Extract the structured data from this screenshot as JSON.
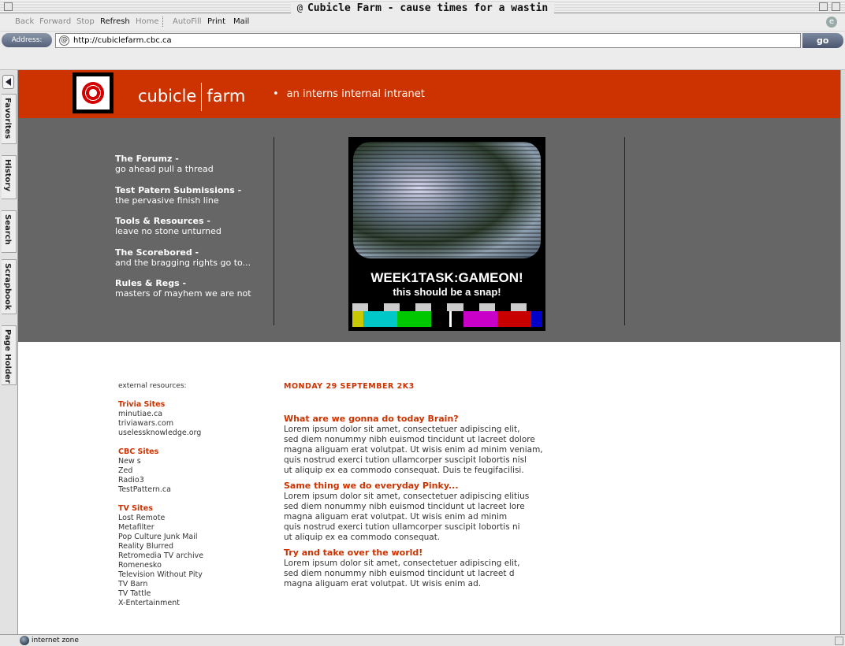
{
  "window": {
    "title": "Cubicle Farm - cause times for a wastin"
  },
  "toolbar": {
    "back": "Back",
    "forward": "Forward",
    "stop": "Stop",
    "refresh": "Refresh",
    "home": "Home",
    "autofill": "AutoFill",
    "print": "Print",
    "mail": "Mail"
  },
  "address": {
    "label": "Address:",
    "url": "http://cubiclefarm.cbc.ca",
    "go": "go"
  },
  "sidebar": {
    "tabs": [
      "Favorites",
      "History",
      "Search",
      "Scrapbook",
      "Page Holder"
    ]
  },
  "site": {
    "brand_left": "cubicle",
    "brand_right": "farm",
    "tagline": "an interns internal intranet",
    "nav": [
      {
        "title": "The Forumz -",
        "sub": "go ahead pull a thread"
      },
      {
        "title": "Test Patern Submissions -",
        "sub": "the pervasive finish line"
      },
      {
        "title": "Tools & Resources -",
        "sub": "leave no stone unturned"
      },
      {
        "title": "The Scorebored -",
        "sub": "and the bragging rights go to..."
      },
      {
        "title": "Rules & Regs -",
        "sub": "masters of mayhem we are not"
      }
    ],
    "promo": {
      "headline": "WEEK1TASK:GAMEON!",
      "subline": "this should be a snap!"
    },
    "external_label": "external resources:",
    "link_sections": [
      {
        "heading": "Trivia Sites",
        "items": [
          "minutiae.ca",
          "triviawars.com",
          "uselessknowledge.org"
        ]
      },
      {
        "heading": "CBC Sites",
        "items": [
          "New s",
          "Zed",
          "Radio3",
          "TestPattern.ca"
        ]
      },
      {
        "heading": "TV Sites",
        "items": [
          "Lost Remote",
          "Metafilter",
          "Pop Culture Junk Mail",
          "Reality Blurred",
          "Retromedia TV archive",
          "Romenesko",
          "Television Without Pity",
          "TV Barn",
          "TV Tattle",
          "X-Entertainment"
        ]
      }
    ],
    "date": "MONDAY 29 SEPTEMBER 2K3",
    "posts": [
      {
        "heading": "What are we gonna do today Brain?",
        "lines": [
          "Lorem ipsum dolor sit amet, consectetuer adipiscing elit,",
          "sed diem nonummy nibh euismod tincidunt ut lacreet dolore",
          "magna aliguam erat volutpat. Ut wisis enim ad minim veniam,",
          "quis nostrud exerci tution ullamcorper suscipit lobortis nisl",
          "ut aliquip ex ea commodo consequat. Duis te feugifacilisi."
        ]
      },
      {
        "heading": "Same thing we do everyday Pinky...",
        "lines": [
          "Lorem ipsum dolor sit amet, consectetuer adipiscing elitius",
          "sed diem nonummy nibh euismod tincidunt ut lacreet lore",
          "magna aliguam erat volutpat. Ut wisis enim ad minim",
          "quis nostrud exerci tution ullamcorper suscipit lobortis ni",
          "ut aliquip ex ea commodo consequat."
        ]
      },
      {
        "heading": "Try and take over the world!",
        "lines": [
          "Lorem ipsum dolor sit amet, consectetuer adipiscing elit,",
          "sed diem nonummy nibh euismod tincidunt ut lacreet d",
          "magna aliguam erat volutpat. Ut wisis enim ad."
        ]
      }
    ]
  },
  "status": {
    "zone": "internet zone"
  },
  "colors": {
    "accent": "#cc3300",
    "band": "#666666"
  }
}
